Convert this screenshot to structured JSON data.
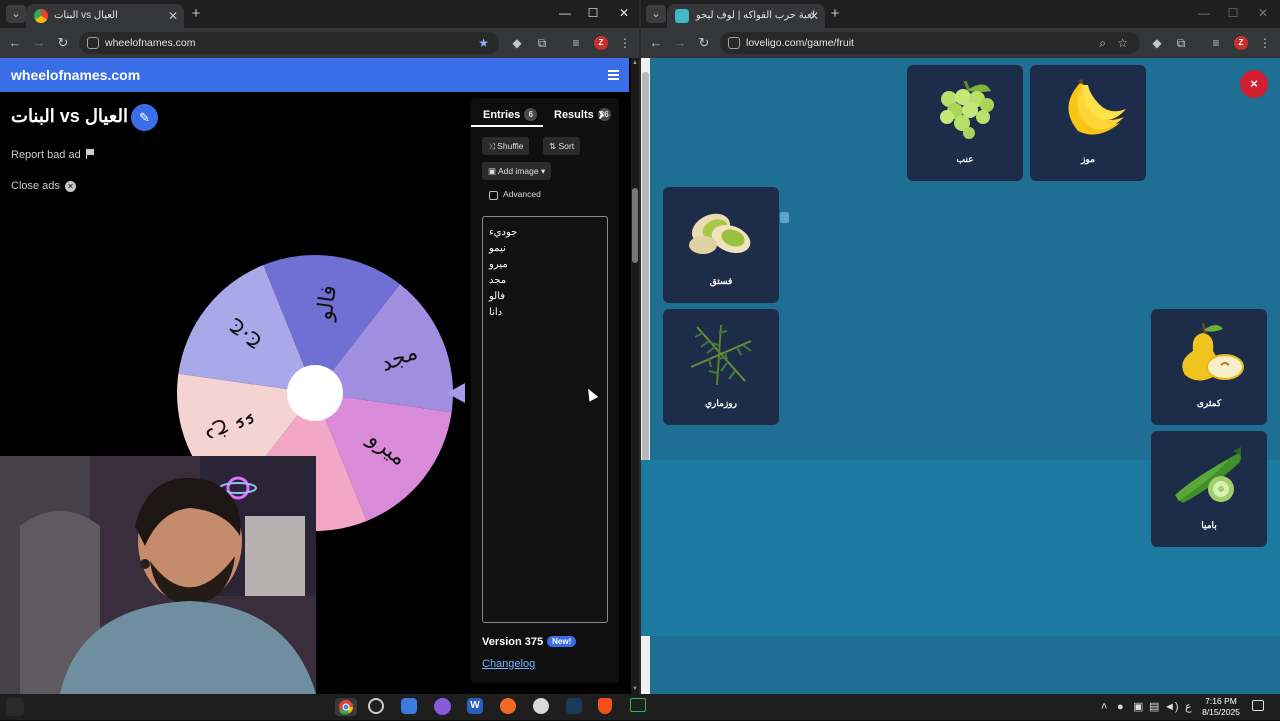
{
  "left_browser": {
    "tab_title": "العيال vs البنات",
    "url": "wheelofnames.com",
    "win_min": "—",
    "win_max": "☐",
    "win_close": "✕"
  },
  "right_browser": {
    "tab_title": "لعبة حرب الفواكه | لوف ليجو يوم",
    "url": "loveligo.com/game/fruit",
    "win_min": "—",
    "win_max": "☐",
    "win_close": "✕"
  },
  "wheel_page": {
    "logo": "wheelofnames.com",
    "title": "البنات vs العيال",
    "report": "Report bad ad",
    "close_ads": "Close ads",
    "tabs": {
      "entries": "Entries",
      "entries_count": "6",
      "results": "Results",
      "results_count": "36"
    },
    "buttons": {
      "shuffle": "Shuffle",
      "sort": "Sort",
      "add_image": "Add image",
      "advanced": "Advanced"
    },
    "entries": [
      "جوديء",
      "نيمو",
      "ميرو",
      "مجد",
      "فالو",
      "دانا"
    ],
    "version": "Version 375",
    "new_badge": "New!",
    "changelog": "Changelog"
  },
  "wheel": {
    "segments": [
      {
        "label": "فالو",
        "color": "#6f6fd4"
      },
      {
        "label": "مجد",
        "color": "#a08ee0"
      },
      {
        "label": "ميرو",
        "color": "#d98ad8"
      },
      {
        "label": "",
        "color": "#f3a7c6"
      },
      {
        "label": "دخ ءء",
        "color": "#f5d3d0"
      },
      {
        "label": "ج.ج",
        "color": "#a9a9ea"
      }
    ],
    "pointer_color": "#a79be8"
  },
  "fruit_game": {
    "close": "×",
    "cards": [
      {
        "label": "عنب",
        "icon": "grapes-icon"
      },
      {
        "label": "موز",
        "icon": "banana-icon"
      },
      {
        "label": "فستق",
        "icon": "pistachio-icon"
      },
      {
        "label": "روزماري",
        "icon": "rosemary-icon"
      },
      {
        "label": "كمثرى",
        "icon": "pear-icon"
      },
      {
        "label": "باميا",
        "icon": "okra-icon"
      }
    ]
  },
  "taskbar": {
    "lang": "ع",
    "time": "7:16 PM",
    "date": "8/15/2025"
  }
}
